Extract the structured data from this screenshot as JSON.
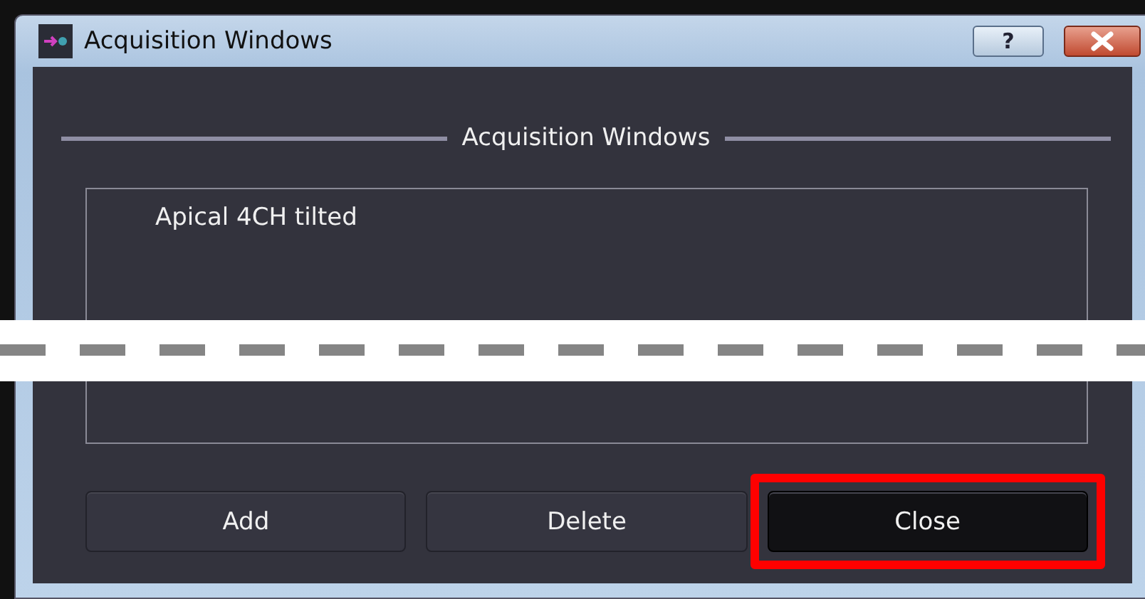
{
  "window": {
    "title": "Acquisition Windows"
  },
  "title_buttons": [
    {
      "kind": "help",
      "label": "?"
    },
    {
      "kind": "close"
    }
  ],
  "group": {
    "title": "Acquisition Windows"
  },
  "list": {
    "items": [
      {
        "label": "Apical 4CH tilted",
        "selected": false
      }
    ]
  },
  "buttons": [
    {
      "label": "Add",
      "default": false,
      "highlighted": false
    },
    {
      "label": "Delete",
      "default": false,
      "highlighted": false
    },
    {
      "label": "Close",
      "default": true,
      "highlighted": true
    }
  ],
  "break_marker": true
}
